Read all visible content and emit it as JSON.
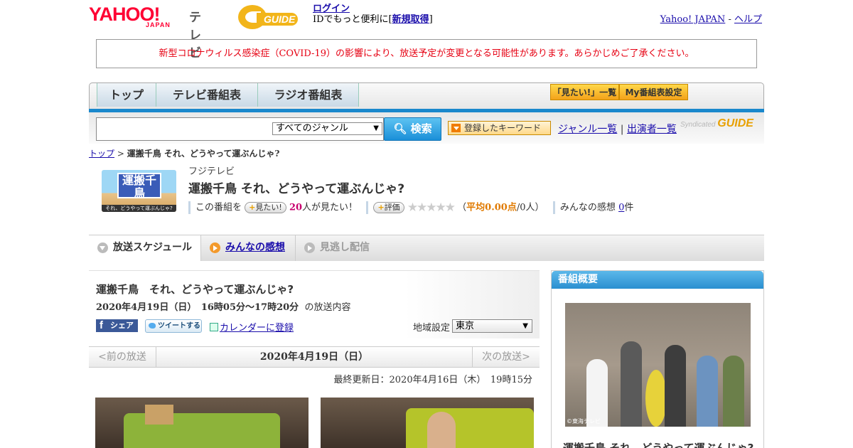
{
  "header": {
    "logo_yahoo": "YAHOO!",
    "logo_japan": "JAPAN",
    "logo_tv": "テレビ",
    "gguide": "GUIDE",
    "login_label": "ログイン",
    "login_sub_prefix": "IDでもっと便利に[",
    "register_label": "新規取得",
    "login_sub_suffix": "]",
    "yahoo_japan_link": "Yahoo! JAPAN",
    "help_link": "ヘルプ",
    "link_sep": "-"
  },
  "notice": "新型コロナウィルス感染症（COVID-19）の影響により、放送予定が変更となる可能性があります。あらかじめご了承ください。",
  "nav": {
    "tabs": [
      "トップ",
      "テレビ番組表",
      "ラジオ番組表"
    ],
    "mitai_list": "「見たい!」一覧",
    "my_settings": "My番組表設定"
  },
  "search": {
    "input_value": "",
    "genre_selected": "すべてのジャンル",
    "button": "検索",
    "keyword_button": "登録したキーワード",
    "genre_list": "ジャンル一覧",
    "divider": "|",
    "performer_list": "出演者一覧",
    "syndicated": "Syndicated",
    "syndicated_brand": "GUIDE"
  },
  "breadcrumb": {
    "home": "トップ",
    "sep": ">",
    "current": "運搬千鳥 それ、どうやって運ぶんじゃ?"
  },
  "program": {
    "thumb_title": "運搬千鳥",
    "thumb_sub": "それ、どうやって運ぶんじゃ?",
    "station": "フジテレビ",
    "title": "運搬千鳥 それ、どうやって運ぶんじゃ?",
    "this_program": "この番組を",
    "mitai_button": "見たい!",
    "mitai_count": "20",
    "mitai_suffix": "人が見たい！",
    "rate_button": "評価",
    "stars": "★★★★★",
    "rating_prefix": "（",
    "rating_avg_label": "平均0.00点",
    "rating_people": "/0人）",
    "impressions_label": "みんなの感想",
    "impressions_count": "0",
    "impressions_suffix": "件"
  },
  "schedule_tabs": [
    "放送スケジュール",
    "みんなの感想",
    "見逃し配信"
  ],
  "broadcast": {
    "title": "運搬千鳥　それ、どうやって運ぶんじゃ?",
    "datetime": "2020年4月19日（日）　16時05分～17時20分",
    "datetime_suffix": "の放送内容",
    "share": "シェア",
    "tweet": "ツイートする",
    "calendar": "カレンダーに登録",
    "region_label": "地域設定",
    "region_value": "東京",
    "prev": "<前の放送",
    "date": "2020年4月19日（日）",
    "next": "次の放送>",
    "updated": "最終更新日：2020年4月16日（木）　19時15分"
  },
  "overview": {
    "heading": "番組概要",
    "credit": "©東海テレビ",
    "title": "運搬千鳥 それ、どうやって運ぶんじゃ?"
  }
}
